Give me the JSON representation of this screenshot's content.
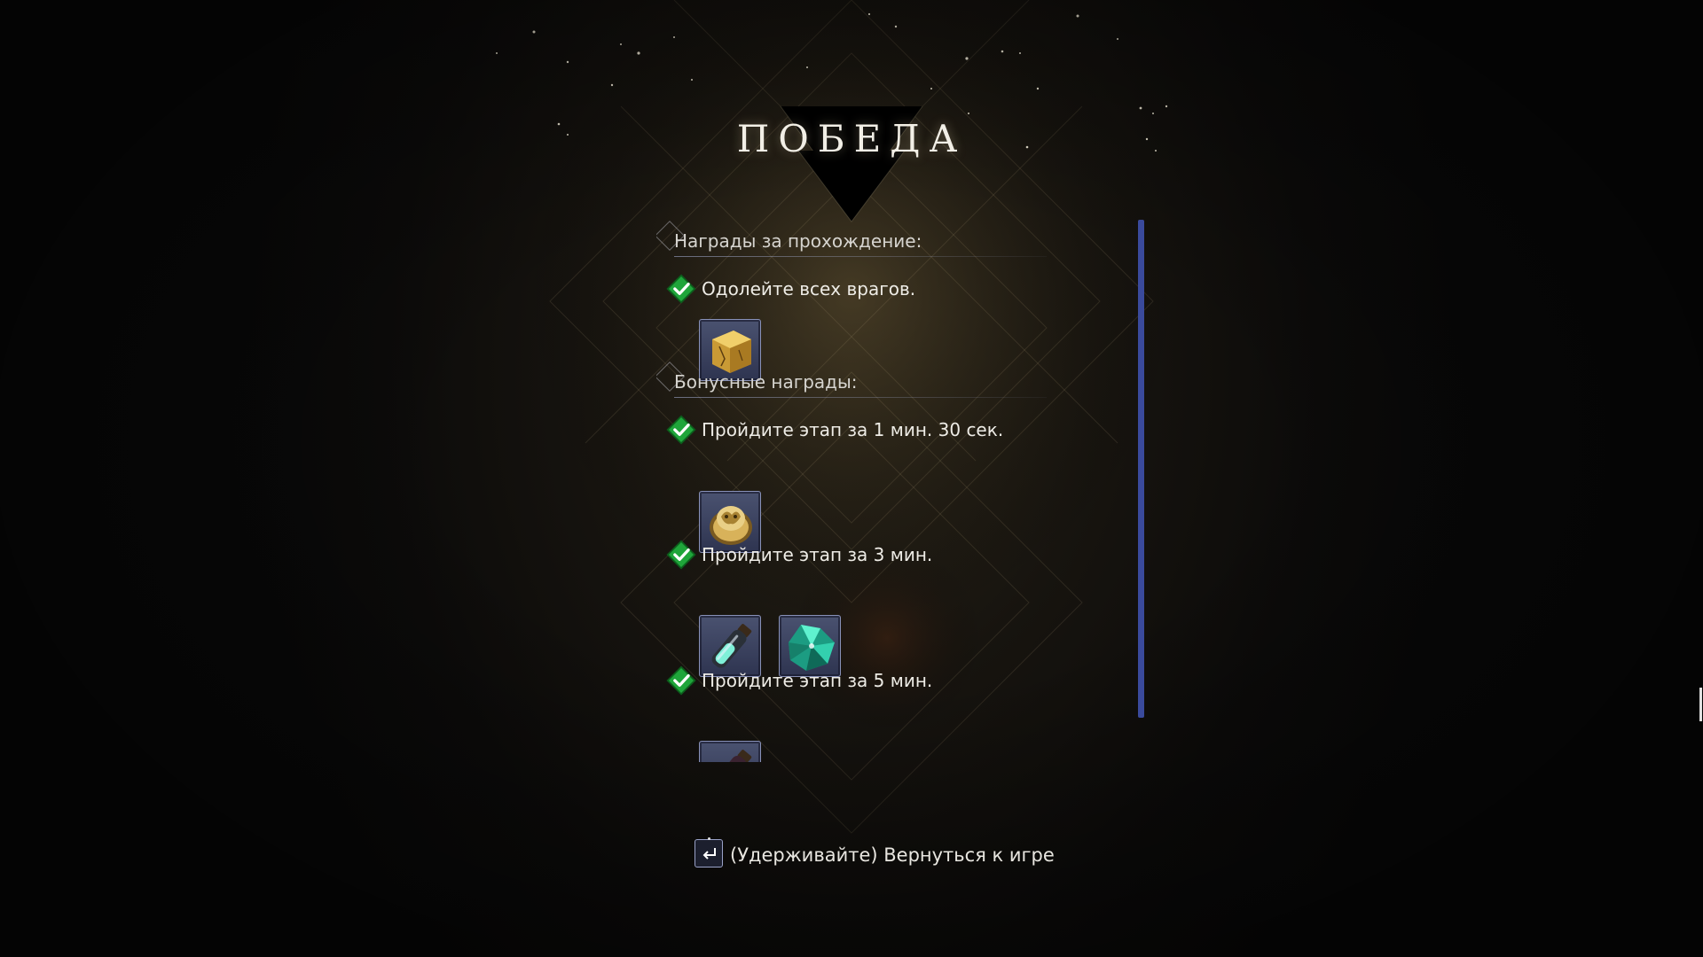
{
  "screen": {
    "title": "ПОБЕДА"
  },
  "sections": [
    {
      "heading": "Награды за прохождение:",
      "objectives": [
        {
          "text": "Одолейте всех врагов.",
          "completed": true,
          "rewards": [
            {
              "icon": "gold-ore-icon"
            }
          ]
        }
      ]
    },
    {
      "heading": "Бонусные награды:",
      "objectives": [
        {
          "text": "Пройдите этап за 1 мин. 30 сек.",
          "completed": true,
          "rewards": [
            {
              "icon": "gold-ring-icon"
            }
          ]
        },
        {
          "text": "Пройдите этап за 3 мин.",
          "completed": true,
          "rewards": [
            {
              "icon": "potion-vial-icon"
            },
            {
              "icon": "green-crystal-icon"
            }
          ]
        },
        {
          "text": "Пройдите этап за 5 мин.",
          "completed": true,
          "rewards": [
            {
              "icon": "red-vial-icon"
            }
          ]
        }
      ]
    }
  ],
  "footer": {
    "key_icon": "enter-key-icon",
    "hint": "(Удерживайте) Вернуться к игре"
  },
  "colors": {
    "check_green": "#1fa53a",
    "scrollbar": "#3a4a9c",
    "item_border": "#8891b8",
    "title": "#f2efe6"
  }
}
